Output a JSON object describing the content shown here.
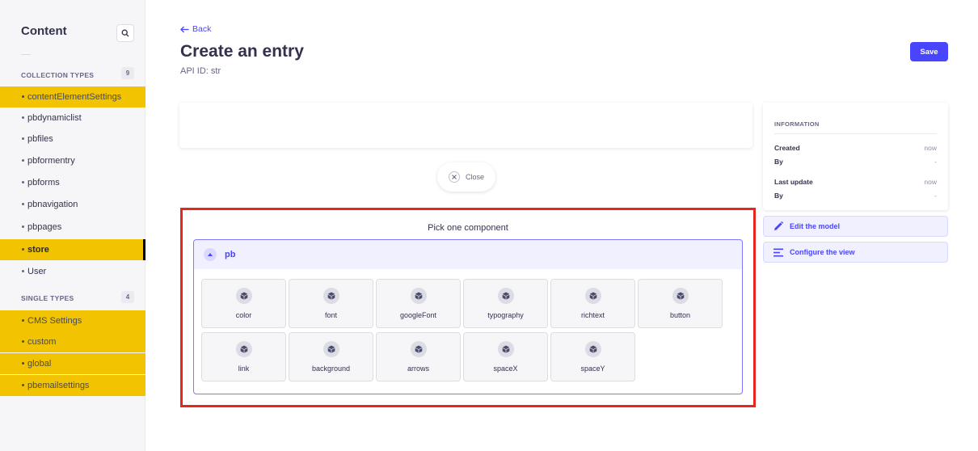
{
  "sidebar": {
    "title": "Content",
    "search_icon": "search-icon",
    "collection_types": {
      "label": "COLLECTION TYPES",
      "count": "9",
      "items": [
        {
          "label": "contentElementSettings"
        },
        {
          "label": "pbdynamiclist"
        },
        {
          "label": "pbfiles"
        },
        {
          "label": "pbformentry"
        },
        {
          "label": "pbforms"
        },
        {
          "label": "pbnavigation"
        },
        {
          "label": "pbpages"
        },
        {
          "label": "store"
        },
        {
          "label": "User"
        }
      ]
    },
    "single_types": {
      "label": "SINGLE TYPES",
      "count": "4",
      "items": [
        {
          "label": "CMS Settings"
        },
        {
          "label": "custom"
        },
        {
          "label": "global"
        },
        {
          "label": "pbemailsettings"
        }
      ]
    }
  },
  "header": {
    "back_label": "Back",
    "title": "Create an entry",
    "api_id": "API ID: str",
    "save_label": "Save"
  },
  "close_button": {
    "label": "Close"
  },
  "picker": {
    "title": "Pick one component",
    "category": "pb",
    "components": [
      {
        "label": "color"
      },
      {
        "label": "font"
      },
      {
        "label": "googleFont"
      },
      {
        "label": "typography"
      },
      {
        "label": "richtext"
      },
      {
        "label": "button"
      },
      {
        "label": "link"
      },
      {
        "label": "background"
      },
      {
        "label": "arrows"
      },
      {
        "label": "spaceX"
      },
      {
        "label": "spaceY"
      }
    ]
  },
  "information": {
    "title": "INFORMATION",
    "rows": [
      {
        "key": "Created",
        "value": "now"
      },
      {
        "key": "By",
        "value": "-"
      },
      {
        "key": "Last update",
        "value": "now"
      },
      {
        "key": "By",
        "value": "-"
      }
    ]
  },
  "actions": {
    "edit_model": "Edit the model",
    "configure_view": "Configure the view"
  },
  "colors": {
    "accent": "#4945ff",
    "highlight": "#f2c300",
    "outline": "#e8271c"
  }
}
